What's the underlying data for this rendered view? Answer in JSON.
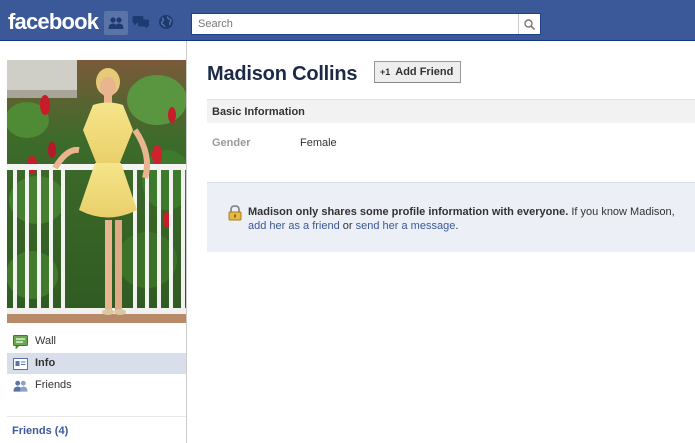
{
  "header": {
    "logo": "facebook",
    "search": {
      "placeholder": "Search"
    }
  },
  "sidebar": {
    "items": [
      {
        "label": "Wall",
        "icon": "wall-icon"
      },
      {
        "label": "Info",
        "icon": "info-icon",
        "active": true
      },
      {
        "label": "Friends",
        "icon": "friends-icon"
      }
    ],
    "friends_count_label": "Friends (4)"
  },
  "profile": {
    "name": "Madison Collins",
    "add_friend_label": "Add Friend",
    "add_friend_icon_text": "+1",
    "section_title": "Basic Information",
    "gender_label": "Gender",
    "gender_value": "Female",
    "notice": {
      "bold": "Madison only shares some profile information with everyone.",
      "text_before": " If you know Madison, ",
      "link_add": "add her as a friend",
      "text_mid": " or ",
      "link_message": "send her a message",
      "text_end": "."
    }
  },
  "colors": {
    "brand_blue": "#3b5998",
    "nav_active_bg": "#d8dfea",
    "notice_bg": "#eceff5"
  }
}
